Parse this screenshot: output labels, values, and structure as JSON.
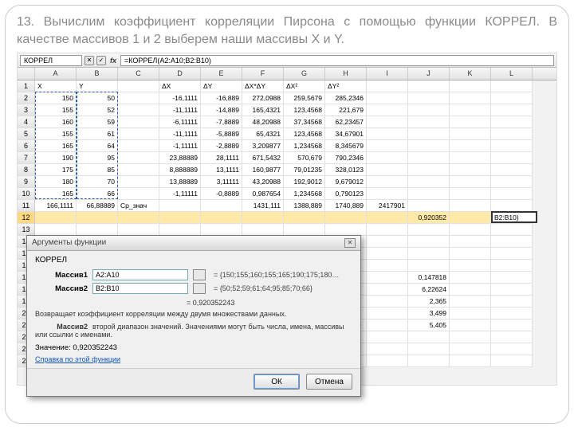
{
  "heading": "13. Вычислим коэффициент корреляции Пирсона с помощью функции КОРРЕЛ. В качестве массивов 1 и 2 выберем наши массивы X и Y.",
  "namebox": "КОРРЕЛ",
  "fx_cancel": "✕",
  "fx_accept": "✓",
  "fx_label": "fx",
  "formula": "=КОРРЕЛ(A2:A10;B2:B10)",
  "cols": [
    "A",
    "B",
    "C",
    "D",
    "E",
    "F",
    "G",
    "H",
    "I",
    "J",
    "K",
    "L"
  ],
  "rows": [
    {
      "n": "1",
      "c": [
        "X",
        "Y",
        "",
        "ΔX",
        "ΔY",
        "ΔX*ΔY",
        "ΔX²",
        "ΔY²",
        "",
        "",
        "",
        ""
      ]
    },
    {
      "n": "2",
      "c": [
        "150",
        "50",
        "",
        "-16,1111",
        "-16,889",
        "272,0988",
        "259,5679",
        "285,2346",
        "",
        "",
        "",
        ""
      ]
    },
    {
      "n": "3",
      "c": [
        "155",
        "52",
        "",
        "-11,1111",
        "-14,889",
        "165,4321",
        "123,4568",
        "221,679",
        "",
        "",
        "",
        ""
      ]
    },
    {
      "n": "4",
      "c": [
        "160",
        "59",
        "",
        "-6,11111",
        "-7,8889",
        "48,20988",
        "37,34568",
        "62,23457",
        "",
        "",
        "",
        ""
      ]
    },
    {
      "n": "5",
      "c": [
        "155",
        "61",
        "",
        "-11,1111",
        "-5,8889",
        "65,4321",
        "123,4568",
        "34,67901",
        "",
        "",
        "",
        ""
      ]
    },
    {
      "n": "6",
      "c": [
        "165",
        "64",
        "",
        "-1,11111",
        "-2,8889",
        "3,209877",
        "1,234568",
        "8,345679",
        "",
        "",
        "",
        ""
      ]
    },
    {
      "n": "7",
      "c": [
        "190",
        "95",
        "",
        "23,88889",
        "28,1111",
        "671,5432",
        "570,679",
        "790,2346",
        "",
        "",
        "",
        ""
      ]
    },
    {
      "n": "8",
      "c": [
        "175",
        "85",
        "",
        "8,888889",
        "13,1111",
        "160,9877",
        "79,01235",
        "328,0123",
        "",
        "",
        "",
        ""
      ]
    },
    {
      "n": "9",
      "c": [
        "180",
        "70",
        "",
        "13,88889",
        "3,11111",
        "43,20988",
        "192,9012",
        "9,679012",
        "",
        "",
        "",
        ""
      ]
    },
    {
      "n": "10",
      "c": [
        "165",
        "66",
        "",
        "-1,11111",
        "-0,8889",
        "0,987654",
        "1,234568",
        "0,790123",
        "",
        "",
        "",
        ""
      ]
    },
    {
      "n": "11",
      "c": [
        "166,1111",
        "66,88889",
        "Ср_знач",
        "",
        "",
        "1431,111",
        "1388,889",
        "1740,889",
        "2417901",
        "",
        "",
        ""
      ]
    },
    {
      "n": "12",
      "c": [
        "",
        "",
        "",
        "",
        "",
        "",
        "",
        "",
        "",
        "0,920352",
        "",
        "B2:B10)"
      ]
    },
    {
      "n": "13",
      "c": [
        "",
        "",
        "",
        "",
        "",
        "",
        "",
        "",
        "",
        "",
        "",
        ""
      ]
    },
    {
      "n": "14",
      "c": [
        "",
        "",
        "",
        "",
        "",
        "",
        "",
        "",
        "",
        "",
        "",
        ""
      ]
    },
    {
      "n": "15",
      "c": [
        "",
        "",
        "",
        "",
        "",
        "",
        "",
        "",
        "",
        "",
        "",
        ""
      ]
    },
    {
      "n": "16",
      "c": [
        "",
        "",
        "",
        "",
        "",
        "",
        "",
        "",
        "",
        "",
        "",
        ""
      ]
    },
    {
      "n": "17",
      "c": [
        "",
        "",
        "",
        "",
        "",
        "",
        "",
        "",
        "",
        "0,147818",
        "",
        ""
      ]
    },
    {
      "n": "18",
      "c": [
        "",
        "",
        "",
        "",
        "",
        "",
        "",
        "",
        "",
        "6,22624",
        "",
        ""
      ]
    },
    {
      "n": "19",
      "c": [
        "",
        "",
        "",
        "",
        "",
        "",
        "",
        "",
        "",
        "2,365",
        "",
        ""
      ]
    },
    {
      "n": "20",
      "c": [
        "",
        "",
        "",
        "",
        "",
        "",
        "",
        "",
        "",
        "3,499",
        "",
        ""
      ]
    },
    {
      "n": "21",
      "c": [
        "",
        "",
        "",
        "",
        "",
        "",
        "",
        "",
        "",
        "5,405",
        "",
        ""
      ]
    },
    {
      "n": "22",
      "c": [
        "",
        "",
        "",
        "",
        "",
        "",
        "",
        "",
        "",
        "",
        "",
        ""
      ]
    },
    {
      "n": "23",
      "c": [
        "",
        "",
        "",
        "",
        "",
        "",
        "",
        "",
        "",
        "",
        "",
        ""
      ]
    },
    {
      "n": "24",
      "c": [
        "",
        "",
        "",
        "",
        "",
        "",
        "",
        "",
        "",
        "",
        "",
        ""
      ]
    }
  ],
  "edit_cell": "B2:B10)",
  "dlg": {
    "title": "Аргументы функции",
    "fnname": "КОРРЕЛ",
    "arg1_label": "Массив1",
    "arg1_value": "A2:A10",
    "arg1_hint": "= {150;155;160;155;165;190;175;180…",
    "arg2_label": "Массив2",
    "arg2_value": "B2:B10",
    "arg2_hint": "= {50;52;59;61;64;95;85;70;66}",
    "result_prefix": "= ",
    "result": "0,920352243",
    "desc1": "Возвращает коэффициент корреляции между двумя множествами данных.",
    "desc2_label": "Массив2",
    "desc2": "второй диапазон значений. Значениями могут быть числа, имена, массивы или ссылки с именами.",
    "value_label": "Значение:",
    "value": "0,920352243",
    "help": "Справка по этой функции",
    "ok": "ОК",
    "cancel": "Отмена"
  }
}
